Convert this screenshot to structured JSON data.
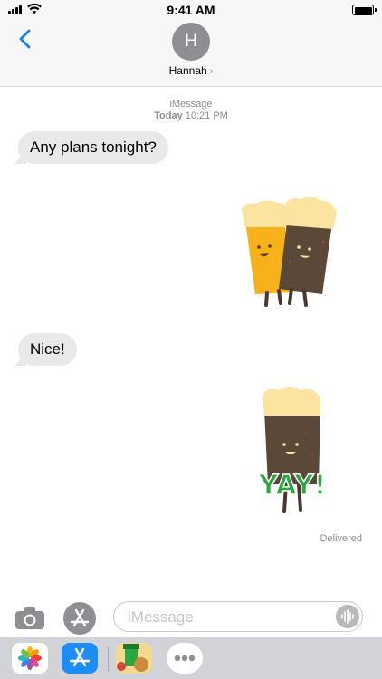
{
  "status_bar": {
    "time": "9:41 AM"
  },
  "header": {
    "avatar_initial": "H",
    "contact_name": "Hannah",
    "contact_chevron": "›"
  },
  "conversation": {
    "service_label": "iMessage",
    "timestamp_day": "Today",
    "timestamp_time": "10:21 PM",
    "messages": [
      {
        "text": "Any plans tonight?"
      },
      {
        "text": "Nice!"
      }
    ],
    "stickers": [
      {
        "name": "beer-cheers-sticker"
      },
      {
        "name": "stout-yay-sticker",
        "text": "YAY!"
      }
    ],
    "delivered_label": "Delivered"
  },
  "input_bar": {
    "placeholder": "iMessage"
  },
  "app_drawer": {
    "apps": [
      {
        "name": "photos-app-icon"
      },
      {
        "name": "app-store-app-icon"
      },
      {
        "name": "sticker-pack-app-icon"
      },
      {
        "name": "more-apps-icon"
      }
    ]
  },
  "colors": {
    "accent": "#147efb",
    "bubble_incoming": "#e9e9eb",
    "secondary_text": "#8e8e93",
    "lager": "#f7b21b",
    "stout": "#5a4839",
    "foam": "#fbe3a0",
    "yay_green": "#2aa83f"
  }
}
